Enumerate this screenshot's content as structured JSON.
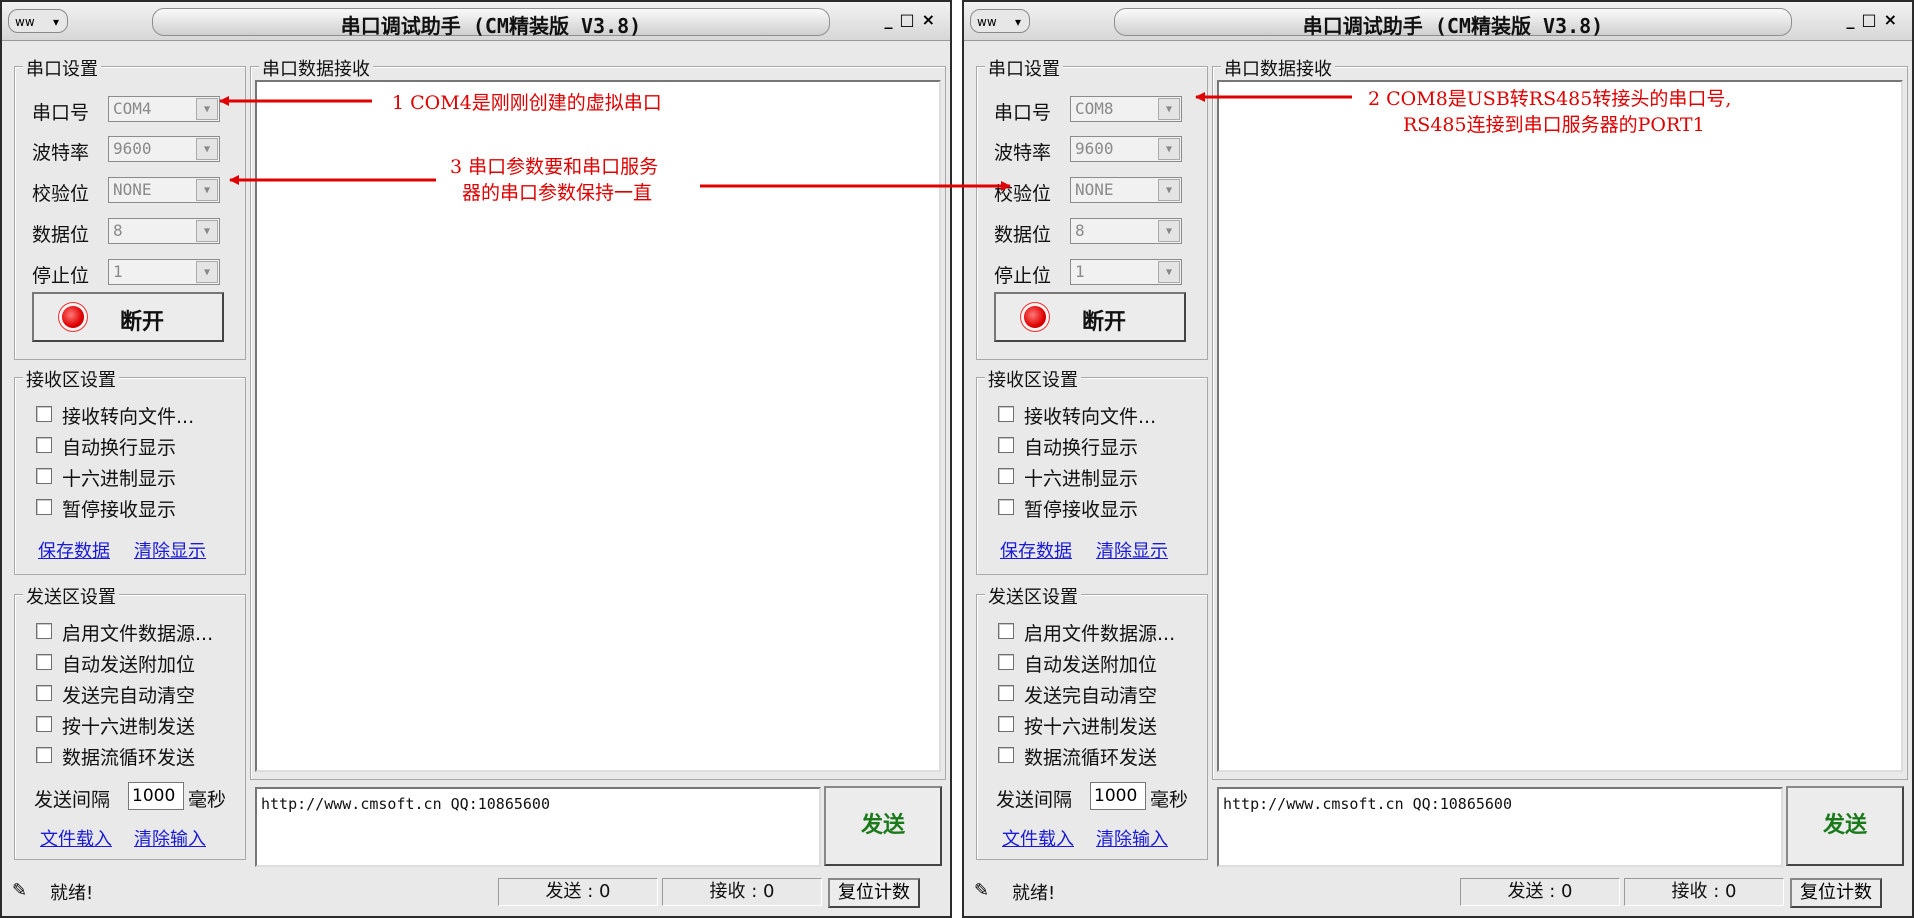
{
  "windows": [
    {
      "id": "left",
      "title": "串口调试助手 (CM精装版 V3.8)",
      "sysmenu_label": "ww",
      "port_group": "串口设置",
      "port_label": "串口号",
      "port_value": "COM4",
      "baud_label": "波特率",
      "baud_value": "9600",
      "parity_label": "校验位",
      "parity_value": "NONE",
      "data_label": "数据位",
      "data_value": "8",
      "stop_label": "停止位",
      "stop_value": "1",
      "open_button": "断开",
      "recv_group": "接收区设置",
      "recv_opts": [
        "接收转向文件...",
        "自动换行显示",
        "十六进制显示",
        "暂停接收显示"
      ],
      "save_link": "保存数据",
      "clear_link": "清除显示",
      "send_group": "发送区设置",
      "send_opts": [
        "启用文件数据源...",
        "自动发送附加位",
        "发送完自动清空",
        "按十六进制发送",
        "数据流循环发送"
      ],
      "interval_label": "发送间隔",
      "interval_value": "1000",
      "interval_unit": "毫秒",
      "load_link": "文件载入",
      "clear_input_link": "清除输入",
      "recv_area_title": "串口数据接收",
      "send_text": "http://www.cmsoft.cn QQ:10865600",
      "send_button": "发送",
      "status_text": "就绪!",
      "sent_count": "发送 : 0",
      "recv_count": "接收 : 0",
      "reset_button": "复位计数"
    },
    {
      "id": "right",
      "title": "串口调试助手 (CM精装版 V3.8)",
      "sysmenu_label": "ww",
      "port_group": "串口设置",
      "port_label": "串口号",
      "port_value": "COM8",
      "baud_label": "波特率",
      "baud_value": "9600",
      "parity_label": "校验位",
      "parity_value": "NONE",
      "data_label": "数据位",
      "data_value": "8",
      "stop_label": "停止位",
      "stop_value": "1",
      "open_button": "断开",
      "recv_group": "接收区设置",
      "recv_opts": [
        "接收转向文件...",
        "自动换行显示",
        "十六进制显示",
        "暂停接收显示"
      ],
      "save_link": "保存数据",
      "clear_link": "清除显示",
      "send_group": "发送区设置",
      "send_opts": [
        "启用文件数据源...",
        "自动发送附加位",
        "发送完自动清空",
        "按十六进制发送",
        "数据流循环发送"
      ],
      "interval_label": "发送间隔",
      "interval_value": "1000",
      "interval_unit": "毫秒",
      "load_link": "文件载入",
      "clear_input_link": "清除输入",
      "recv_area_title": "串口数据接收",
      "send_text": "http://www.cmsoft.cn QQ:10865600",
      "send_button": "发送",
      "status_text": "就绪!",
      "sent_count": "发送 : 0",
      "recv_count": "接收 : 0",
      "reset_button": "复位计数"
    }
  ],
  "annotations": {
    "note1": "1 COM4是刚刚创建的虚拟串口",
    "note2_line1": "2 COM8是USB转RS485转接头的串口号,",
    "note2_line2": "RS485连接到串口服务器的PORT1",
    "note3_line1": "3 串口参数要和串口服务",
    "note3_line2": "器的串口参数保持一直"
  },
  "colors": {
    "annotation": "#e00000",
    "link": "#1a1ad8",
    "send_button_text": "#1a7a1a"
  }
}
